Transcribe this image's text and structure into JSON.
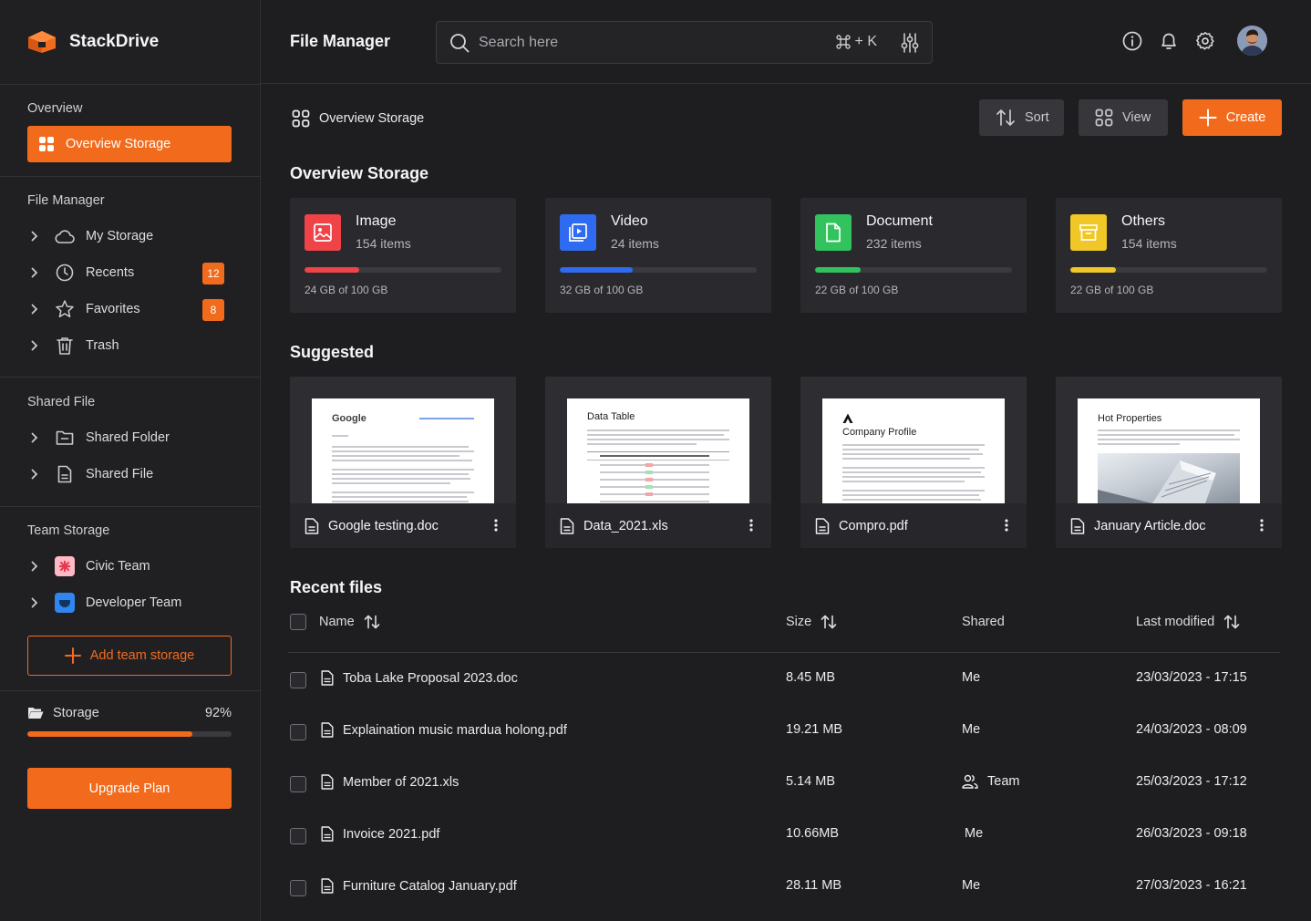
{
  "brand": {
    "name": "StackDrive"
  },
  "sidebar": {
    "overview_title": "Overview",
    "overview_item": "Overview Storage",
    "file_manager_title": "File Manager",
    "file_manager_items": [
      {
        "label": "My Storage"
      },
      {
        "label": "Recents",
        "badge": "12"
      },
      {
        "label": "Favorites",
        "badge": "8"
      },
      {
        "label": "Trash"
      }
    ],
    "shared_title": "Shared File",
    "shared_items": [
      {
        "label": "Shared Folder"
      },
      {
        "label": "Shared File"
      }
    ],
    "team_title": "Team Storage",
    "team_items": [
      {
        "label": "Civic Team"
      },
      {
        "label": "Developer Team"
      }
    ],
    "add_team": "Add team storage",
    "storage_label": "Storage",
    "storage_percent": "92%",
    "storage_fill": 0.81,
    "upgrade": "Upgrade Plan"
  },
  "topbar": {
    "title": "File Manager",
    "search_placeholder": "Search here",
    "shortcut_plus": "+ K"
  },
  "toolbar": {
    "breadcrumb": "Overview Storage",
    "sort": "Sort",
    "view": "View",
    "create": "Create"
  },
  "overview": {
    "heading": "Overview Storage",
    "categories": [
      {
        "name": "Image",
        "count": "154 items",
        "size": "24 GB of 100 GB",
        "fraction": 0.28,
        "color": "#f04348"
      },
      {
        "name": "Video",
        "count": "24 items",
        "size": "32 GB of 100 GB",
        "fraction": 0.37,
        "color": "#2f6bf0"
      },
      {
        "name": "Document",
        "count": "232 items",
        "size": "22 GB of 100 GB",
        "fraction": 0.23,
        "color": "#32c35e"
      },
      {
        "name": "Others",
        "count": "154 items",
        "size": "22 GB of 100 GB",
        "fraction": 0.23,
        "color": "#f0c726"
      }
    ]
  },
  "suggested": {
    "heading": "Suggested",
    "files": [
      {
        "name": "Google testing.doc",
        "preview_title": "Google"
      },
      {
        "name": "Data_2021.xls",
        "preview_title": "Data Table"
      },
      {
        "name": "Compro.pdf",
        "preview_title": "Company Profile"
      },
      {
        "name": "January Article.doc",
        "preview_title": "Hot Properties"
      }
    ]
  },
  "recent": {
    "heading": "Recent files",
    "columns": {
      "name": "Name",
      "size": "Size",
      "shared": "Shared",
      "modified": "Last modified"
    },
    "rows": [
      {
        "name": "Toba Lake Proposal 2023.doc",
        "size": "8.45 MB",
        "shared": "Me",
        "modified": "23/03/2023 - 17:15"
      },
      {
        "name": "Explaination music mardua holong.pdf",
        "size": "19.21 MB",
        "shared": "Me",
        "modified": "24/03/2023 - 08:09"
      },
      {
        "name": "Member of 2021.xls",
        "size": "5.14 MB",
        "shared": "Team",
        "modified": "25/03/2023 - 17:12"
      },
      {
        "name": "Invoice 2021.pdf",
        "size": "10.66MB",
        "shared": "Me",
        "modified": "26/03/2023 - 09:18"
      },
      {
        "name": "Furniture Catalog January.pdf",
        "size": "28.11 MB",
        "shared": "Me",
        "modified": "27/03/2023 - 16:21"
      }
    ]
  },
  "colors": {
    "accent": "#f26b1d",
    "background": "#1e1e21",
    "card": "#2a2a2e"
  }
}
